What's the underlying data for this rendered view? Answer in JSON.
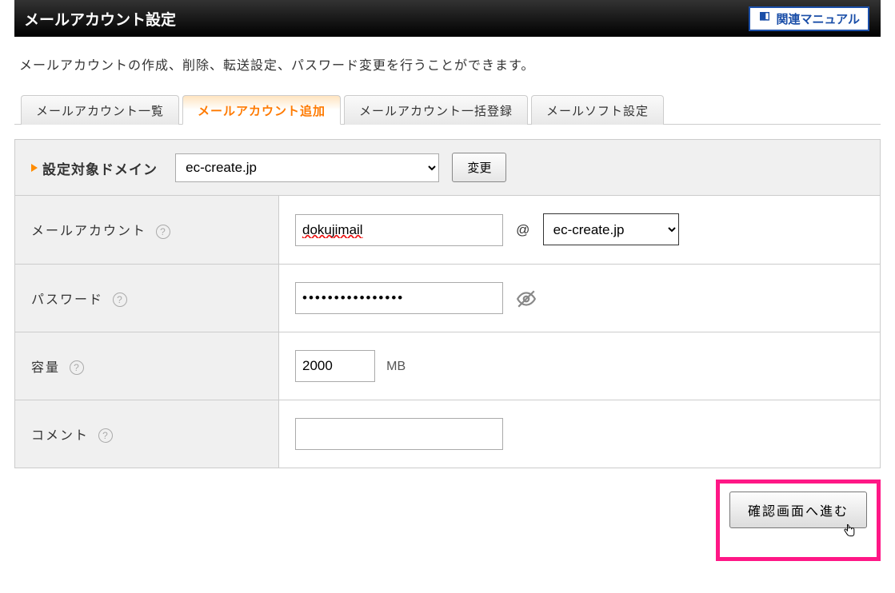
{
  "header": {
    "title": "メールアカウント設定",
    "manual_label": "関連マニュアル"
  },
  "description": "メールアカウントの作成、削除、転送設定、パスワード変更を行うことができます。",
  "tabs": [
    {
      "label": "メールアカウント一覧"
    },
    {
      "label": "メールアカウント追加"
    },
    {
      "label": "メールアカウント一括登録"
    },
    {
      "label": "メールソフト設定"
    }
  ],
  "form": {
    "domain_label": "設定対象ドメイン",
    "domain_value": "ec-create.jp",
    "change_label": "変更",
    "account_label": "メールアカウント",
    "account_value": "dokujimail",
    "at": "@",
    "account_domain_value": "ec-create.jp",
    "password_label": "パスワード",
    "password_value": "••••••••••••••••",
    "capacity_label": "容量",
    "capacity_value": "2000",
    "capacity_unit": "MB",
    "comment_label": "コメント",
    "comment_value": ""
  },
  "submit_label": "確認画面へ進む"
}
